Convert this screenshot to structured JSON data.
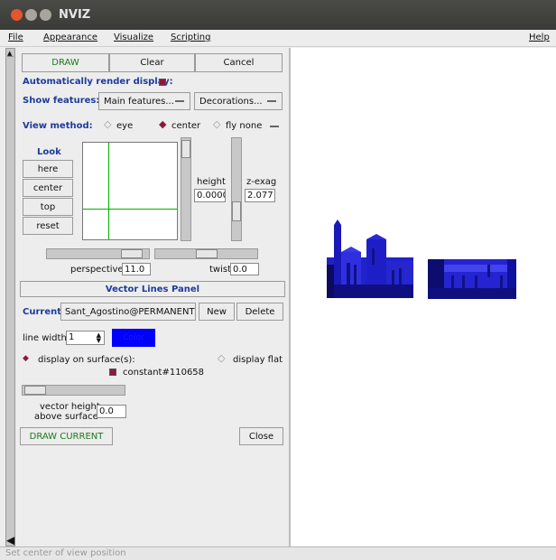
{
  "window": {
    "title": "NVIZ"
  },
  "menubar": {
    "file": "File",
    "appearance": "Appearance",
    "visualize": "Visualize",
    "scripting": "Scripting",
    "help": "Help"
  },
  "toolbar": {
    "draw": "DRAW",
    "clear": "Clear",
    "cancel": "Cancel"
  },
  "auto_render": {
    "label": "Automatically render display:"
  },
  "show_features": {
    "label": "Show features:",
    "main": "Main features...",
    "decorations": "Decorations..."
  },
  "view_method": {
    "label": "View method:",
    "eye": "eye",
    "center": "center",
    "fly": "fly none"
  },
  "look": {
    "label": "Look",
    "here": "here",
    "center": "center",
    "top": "top",
    "reset": "reset"
  },
  "height": {
    "label": "height",
    "value": "0.0000"
  },
  "zexag": {
    "label": "z-exag",
    "value": "2.077"
  },
  "perspective": {
    "label": "perspective",
    "value": "11.0"
  },
  "twist": {
    "label": "twist",
    "value": "0.0"
  },
  "vector_panel": {
    "title": "Vector Lines Panel",
    "current_label": "Current:",
    "current_value": "Sant_Agostino@PERMANENT",
    "new": "New",
    "delete": "Delete",
    "line_width_label": "line width",
    "line_width_value": "1",
    "color_label": "Color",
    "display_on_surface": "display on surface(s):",
    "display_flat": "display flat",
    "surface": "constant#110658",
    "vector_height_label_1": "vector height",
    "vector_height_label_2": "above surface",
    "vector_height_value": "0.0",
    "draw_current": "DRAW CURRENT",
    "close": "Close"
  },
  "statusbar": {
    "text": "Set center of view position"
  },
  "colors": {
    "accent": "#1c3c9c",
    "vector_color": "#0000ff",
    "checkbox": "#8b1a3a"
  }
}
